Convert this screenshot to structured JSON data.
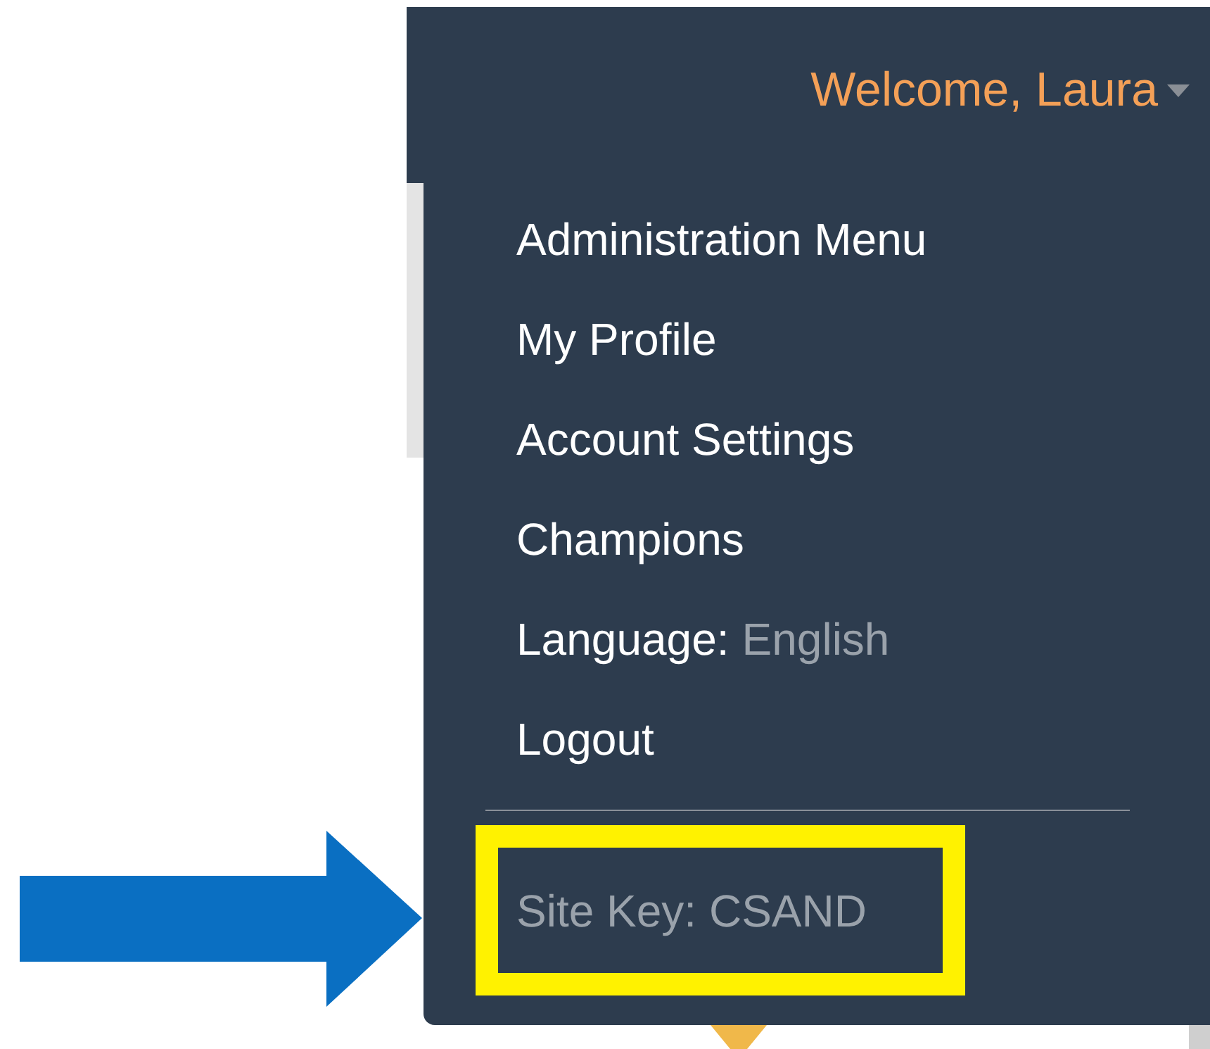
{
  "header": {
    "greeting": "Welcome, Laura",
    "expanded": true
  },
  "menu": {
    "items": [
      {
        "kind": "link",
        "label": "Administration Menu"
      },
      {
        "kind": "link",
        "label": "My Profile"
      },
      {
        "kind": "link",
        "label": "Account Settings"
      },
      {
        "kind": "link",
        "label": "Champions"
      },
      {
        "kind": "setting",
        "label": "Language:",
        "value": "English"
      },
      {
        "kind": "link",
        "label": "Logout"
      }
    ],
    "footer": "Site Key: CSAND"
  },
  "annotations": {
    "arrow": true,
    "highlight_frame": true
  }
}
